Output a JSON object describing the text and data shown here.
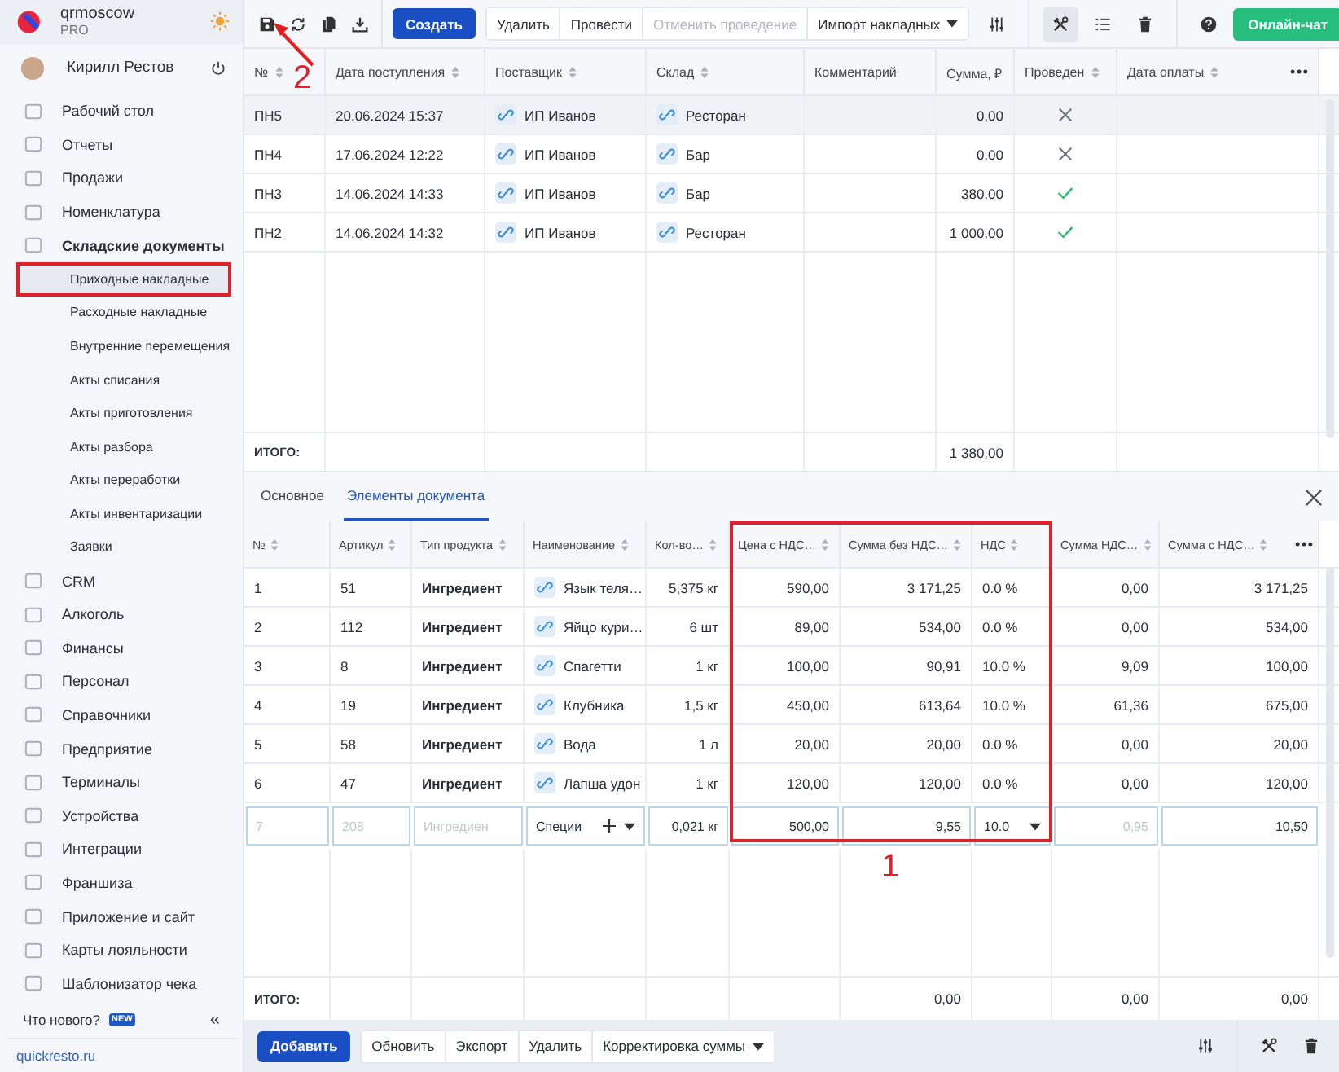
{
  "sidebar": {
    "brand": {
      "name": "qrmoscow",
      "plan": "PRO"
    },
    "user": {
      "name": "Кирилл Рестов"
    },
    "items": [
      {
        "label": "Рабочий стол",
        "expanded": false
      },
      {
        "label": "Отчеты",
        "expanded": false
      },
      {
        "label": "Продажи",
        "expanded": false
      },
      {
        "label": "Номенклатура",
        "expanded": false
      },
      {
        "label": "Складские документы",
        "expanded": true,
        "children": [
          {
            "label": "Приходные накладные",
            "selected": true
          },
          {
            "label": "Расходные накладные",
            "selected": false
          },
          {
            "label": "Внутренние перемещения",
            "selected": false
          },
          {
            "label": "Акты списания",
            "selected": false
          },
          {
            "label": "Акты приготовления",
            "selected": false
          },
          {
            "label": "Акты разбора",
            "selected": false
          },
          {
            "label": "Акты переработки",
            "selected": false
          },
          {
            "label": "Акты инвентаризации",
            "selected": false
          },
          {
            "label": "Заявки",
            "selected": false
          }
        ]
      },
      {
        "label": "CRM",
        "expanded": false
      },
      {
        "label": "Алкоголь",
        "expanded": false
      },
      {
        "label": "Финансы",
        "expanded": false
      },
      {
        "label": "Персонал",
        "expanded": false
      },
      {
        "label": "Справочники",
        "expanded": false
      },
      {
        "label": "Предприятие",
        "expanded": false
      },
      {
        "label": "Терминалы",
        "expanded": false
      },
      {
        "label": "Устройства",
        "expanded": false
      },
      {
        "label": "Интеграции",
        "expanded": false
      },
      {
        "label": "Франшиза",
        "expanded": false
      },
      {
        "label": "Приложение и сайт",
        "expanded": false
      },
      {
        "label": "Карты лояльности",
        "expanded": false
      },
      {
        "label": "Шаблонизатор чека",
        "expanded": false
      }
    ],
    "whats_new": {
      "label": "Что нового?",
      "badge": "NEW"
    },
    "collapse": "«",
    "link": "quickresto.ru"
  },
  "toolbar": {
    "create": "Создать",
    "actions": [
      {
        "label": "Удалить",
        "disabled": false
      },
      {
        "label": "Провести",
        "disabled": false
      },
      {
        "label": "Отменить проведение",
        "disabled": true
      }
    ],
    "import": "Импорт накладных",
    "chat": "Онлайн-чат"
  },
  "documents": {
    "columns": [
      {
        "label": "№",
        "sortable": true
      },
      {
        "label": "Дата поступления",
        "sortable": true
      },
      {
        "label": "Поставщик",
        "sortable": true
      },
      {
        "label": "Склад",
        "sortable": true
      },
      {
        "label": "Комментарий",
        "sortable": false
      },
      {
        "label": "Сумма, ₽",
        "sortable": false,
        "total": "1 380,00"
      },
      {
        "label": "Проведен",
        "sortable": true
      },
      {
        "label": "Дата оплаты",
        "sortable": true
      }
    ],
    "rows": [
      {
        "number": "ПН5",
        "date": "20.06.2024 15:37",
        "supplier": "ИП Иванов",
        "warehouse": "Ресторан",
        "amount": "0,00",
        "posted": false,
        "selected": true
      },
      {
        "number": "ПН4",
        "date": "17.06.2024 12:22",
        "supplier": "ИП Иванов",
        "warehouse": "Бар",
        "amount": "0,00",
        "posted": false,
        "selected": false
      },
      {
        "number": "ПН3",
        "date": "14.06.2024 14:33",
        "supplier": "ИП Иванов",
        "warehouse": "Бар",
        "amount": "380,00",
        "posted": true,
        "selected": false
      },
      {
        "number": "ПН2",
        "date": "14.06.2024 14:32",
        "supplier": "ИП Иванов",
        "warehouse": "Ресторан",
        "amount": "1 000,00",
        "posted": true,
        "selected": false
      }
    ],
    "totals": {
      "label": "ИТОГО:"
    }
  },
  "details": {
    "tabs": [
      {
        "label": "Основное",
        "selected": false
      },
      {
        "label": "Элементы документа",
        "selected": true
      }
    ],
    "columns": [
      {
        "label": "№",
        "highlighted": false
      },
      {
        "label": "Артикул",
        "highlighted": false
      },
      {
        "label": "Тип продукта",
        "highlighted": false
      },
      {
        "label": "Наименование",
        "highlighted": false
      },
      {
        "label": "Кол-во…",
        "highlighted": false
      },
      {
        "label": "Цена с НДС…",
        "highlighted": true
      },
      {
        "label": "Сумма без НДС…",
        "highlighted": true,
        "total": "0,00"
      },
      {
        "label": "НДС",
        "highlighted": true
      },
      {
        "label": "Сумма НДС…",
        "highlighted": false,
        "total": "0,00"
      },
      {
        "label": "Сумма с НДС…",
        "highlighted": false,
        "total": "0,00"
      }
    ],
    "rows": [
      {
        "kind": "item",
        "cells": [
          "1",
          "51",
          "Ингредиент",
          "Язык теля…",
          "5,375 кг",
          "590,00",
          "3 171,25",
          "0.0 %",
          "0,00",
          "3 171,25"
        ]
      },
      {
        "kind": "item",
        "cells": [
          "2",
          "112",
          "Ингредиент",
          "Яйцо кури…",
          "6 шт",
          "89,00",
          "534,00",
          "0.0 %",
          "0,00",
          "534,00"
        ]
      },
      {
        "kind": "item",
        "cells": [
          "3",
          "8",
          "Ингредиент",
          "Спагетти",
          "1 кг",
          "100,00",
          "90,91",
          "10.0 %",
          "9,09",
          "100,00"
        ]
      },
      {
        "kind": "item",
        "cells": [
          "4",
          "19",
          "Ингредиент",
          "Клубника",
          "1,5 кг",
          "450,00",
          "613,64",
          "10.0 %",
          "61,36",
          "675,00"
        ]
      },
      {
        "kind": "item",
        "cells": [
          "5",
          "58",
          "Ингредиент",
          "Вода",
          "1 л",
          "20,00",
          "20,00",
          "0.0 %",
          "0,00",
          "20,00"
        ]
      },
      {
        "kind": "item",
        "cells": [
          "6",
          "47",
          "Ингредиент",
          "Лапша удон",
          "1 кг",
          "120,00",
          "120,00",
          "0.0 %",
          "0,00",
          "120,00"
        ]
      },
      {
        "kind": "edit",
        "cells": [
          {
            "kind": "input",
            "value": "7",
            "disabled": true
          },
          {
            "kind": "input",
            "value": "208",
            "disabled": true
          },
          {
            "kind": "input",
            "placeholder": "Ингредиен",
            "disabled": true
          },
          {
            "kind": "product",
            "value": "Специи",
            "disabled": false
          },
          {
            "kind": "input",
            "value": "0,021 кг",
            "disabled": false
          },
          {
            "kind": "input",
            "value": "500,00",
            "disabled": false
          },
          {
            "kind": "input",
            "value": "9,55",
            "disabled": false
          },
          {
            "kind": "select",
            "value": "10.0",
            "disabled": false
          },
          {
            "kind": "input",
            "value": "0,95",
            "disabled": true
          },
          {
            "kind": "input",
            "value": "10,50",
            "disabled": false
          }
        ]
      }
    ],
    "totals": {
      "label": "ИТОГО:"
    }
  },
  "bottom_toolbar": {
    "add": "Добавить",
    "actions": [
      "Обновить",
      "Экспорт",
      "Удалить"
    ],
    "correction": "Корректировка суммы"
  },
  "annotations": [
    {
      "label": "2"
    },
    {
      "label": "1"
    }
  ]
}
